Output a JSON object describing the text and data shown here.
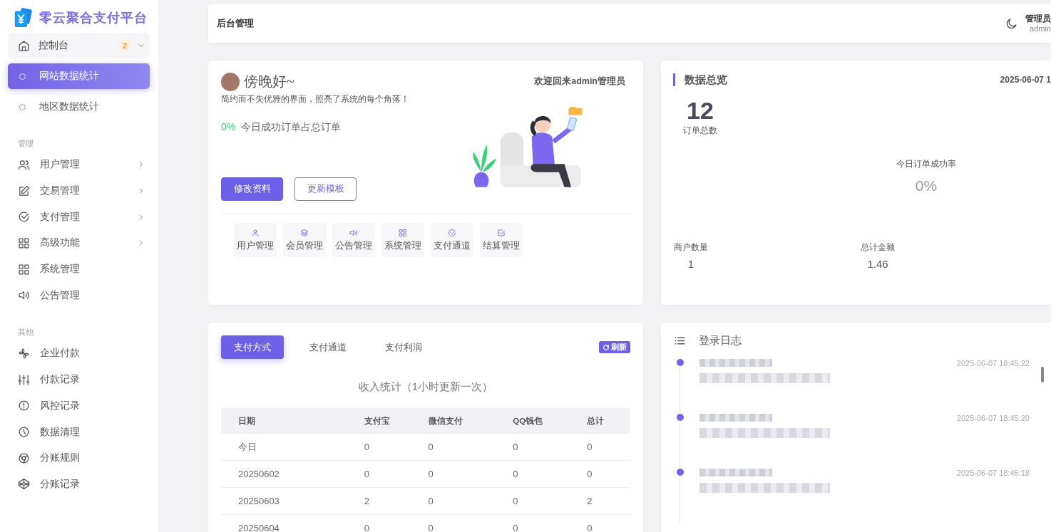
{
  "sidebar": {
    "brand": "零云聚合支付平台",
    "dashboard": {
      "label": "控制台",
      "badge": "2",
      "expanded": true,
      "children": [
        {
          "label": "网站数据统计",
          "selected": true
        },
        {
          "label": "地区数据统计",
          "selected": false
        }
      ]
    },
    "sections": [
      {
        "title": "管理",
        "items": [
          {
            "label": "用户管理",
            "has_submenu": true
          },
          {
            "label": "交易管理",
            "has_submenu": true
          },
          {
            "label": "支付管理",
            "has_submenu": true
          },
          {
            "label": "高级功能",
            "has_submenu": true
          },
          {
            "label": "系统管理",
            "has_submenu": false
          },
          {
            "label": "公告管理",
            "has_submenu": false
          }
        ]
      },
      {
        "title": "其他",
        "items": [
          {
            "label": "企业付款",
            "has_submenu": false
          },
          {
            "label": "付款记录",
            "has_submenu": false
          },
          {
            "label": "风控记录",
            "has_submenu": false
          },
          {
            "label": "数据清理",
            "has_submenu": false
          },
          {
            "label": "分账规则",
            "has_submenu": false
          },
          {
            "label": "分账记录",
            "has_submenu": false
          }
        ]
      }
    ]
  },
  "topbar": {
    "title": "后台管理",
    "user_role": "管理员",
    "user_name": "admin"
  },
  "welcome": {
    "greeting": "傍晚好~",
    "welcome_text": "欢迎回来admin管理员",
    "tagline": "简约而不失优雅的界面，照亮了系统的每个角落！",
    "rate": "0%",
    "rate_label": "今日成功订单占总订单",
    "buttons": [
      {
        "label": "修改资料",
        "primary": true
      },
      {
        "label": "更新模板",
        "primary": false
      }
    ],
    "shortcuts": [
      "用户管理",
      "会员管理",
      "公告管理",
      "系统管理",
      "支付通道",
      "结算管理"
    ]
  },
  "overview": {
    "title": "数据总览",
    "datetime": "2025-06-07 1",
    "total_orders": "12",
    "total_orders_label": "订单总数",
    "success_rate_label": "今日订单成功率",
    "success_rate": "0%",
    "stats": [
      {
        "label": "商户数量",
        "value": "1"
      },
      {
        "label": "总计金额",
        "value": "1.46"
      }
    ]
  },
  "income": {
    "tabs": [
      {
        "label": "支付方式",
        "selected": true
      },
      {
        "label": "支付通道",
        "selected": false
      },
      {
        "label": "支付利润",
        "selected": false
      }
    ],
    "refresh": "刷新",
    "title": "收入统计（1小时更新一次）",
    "table": {
      "columns": [
        "日期",
        "支付宝",
        "微信支付",
        "QQ钱包",
        "总计"
      ],
      "rows": [
        [
          "今日",
          "0",
          "0",
          "0",
          "0"
        ],
        [
          "20250602",
          "0",
          "0",
          "0",
          "0"
        ],
        [
          "20250603",
          "2",
          "0",
          "0",
          "2"
        ],
        [
          "20250604",
          "0",
          "0",
          "0",
          "0"
        ]
      ]
    }
  },
  "login_log": {
    "title": "登录日志",
    "entries": [
      {
        "time": "2025-06-07 18:45:22"
      },
      {
        "time": "2025-06-07 18:45:20"
      },
      {
        "time": "2025-06-07 18:45:18"
      }
    ]
  }
}
